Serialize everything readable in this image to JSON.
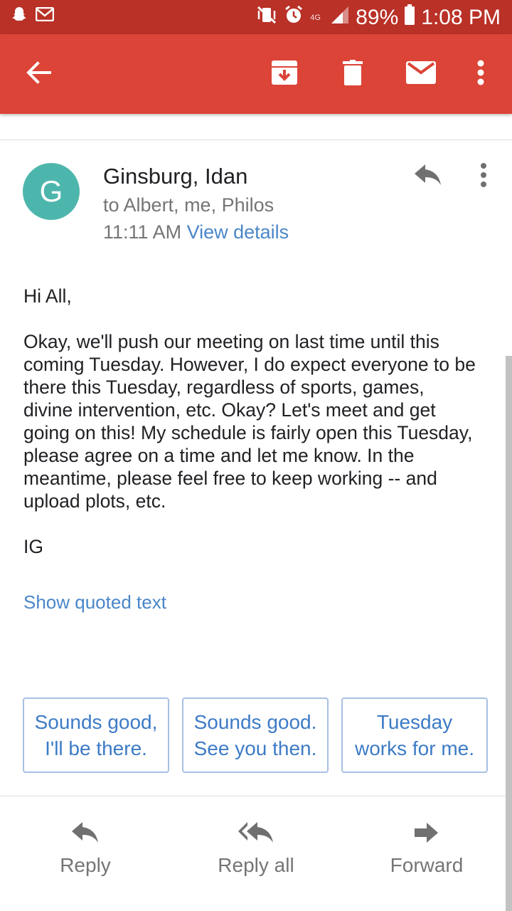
{
  "status_bar": {
    "battery": "89%",
    "time": "1:08 PM",
    "network_label": "4G"
  },
  "toolbar": {
    "icons": [
      "back-arrow-icon",
      "archive-icon",
      "delete-icon",
      "mark-unread-icon",
      "more-vert-icon"
    ]
  },
  "message": {
    "avatar_letter": "G",
    "avatar_color": "#4db6ac",
    "sender": "Ginsburg, Idan",
    "recipients": "to Albert, me, Philos",
    "time": "11:11 AM",
    "view_details": "View details",
    "greeting": "Hi All,",
    "body_lines": [
      "Okay, we'll push our meeting on last time until this",
      "coming Tuesday. However, I do expect everyone to be",
      "there this Tuesday, regardless of sports, games,",
      "divine intervention, etc. Okay? Let's meet and get",
      "going on this! My schedule is fairly open this Tuesday,",
      "please agree on a time and let me know. In the",
      "meantime, please feel free to keep working -- and",
      "upload plots, etc."
    ],
    "signature": "IG",
    "show_quoted": "Show quoted text"
  },
  "smart_replies": [
    {
      "line1": "Sounds good,",
      "line2": "I'll be there."
    },
    {
      "line1": "Sounds good.",
      "line2": "See you then."
    },
    {
      "line1": "Tuesday",
      "line2": "works for me."
    }
  ],
  "actions": {
    "reply": "Reply",
    "reply_all": "Reply all",
    "forward": "Forward"
  },
  "colors": {
    "status_bar": "#b93127",
    "app_bar": "#db4437",
    "link": "#4a86c8"
  }
}
